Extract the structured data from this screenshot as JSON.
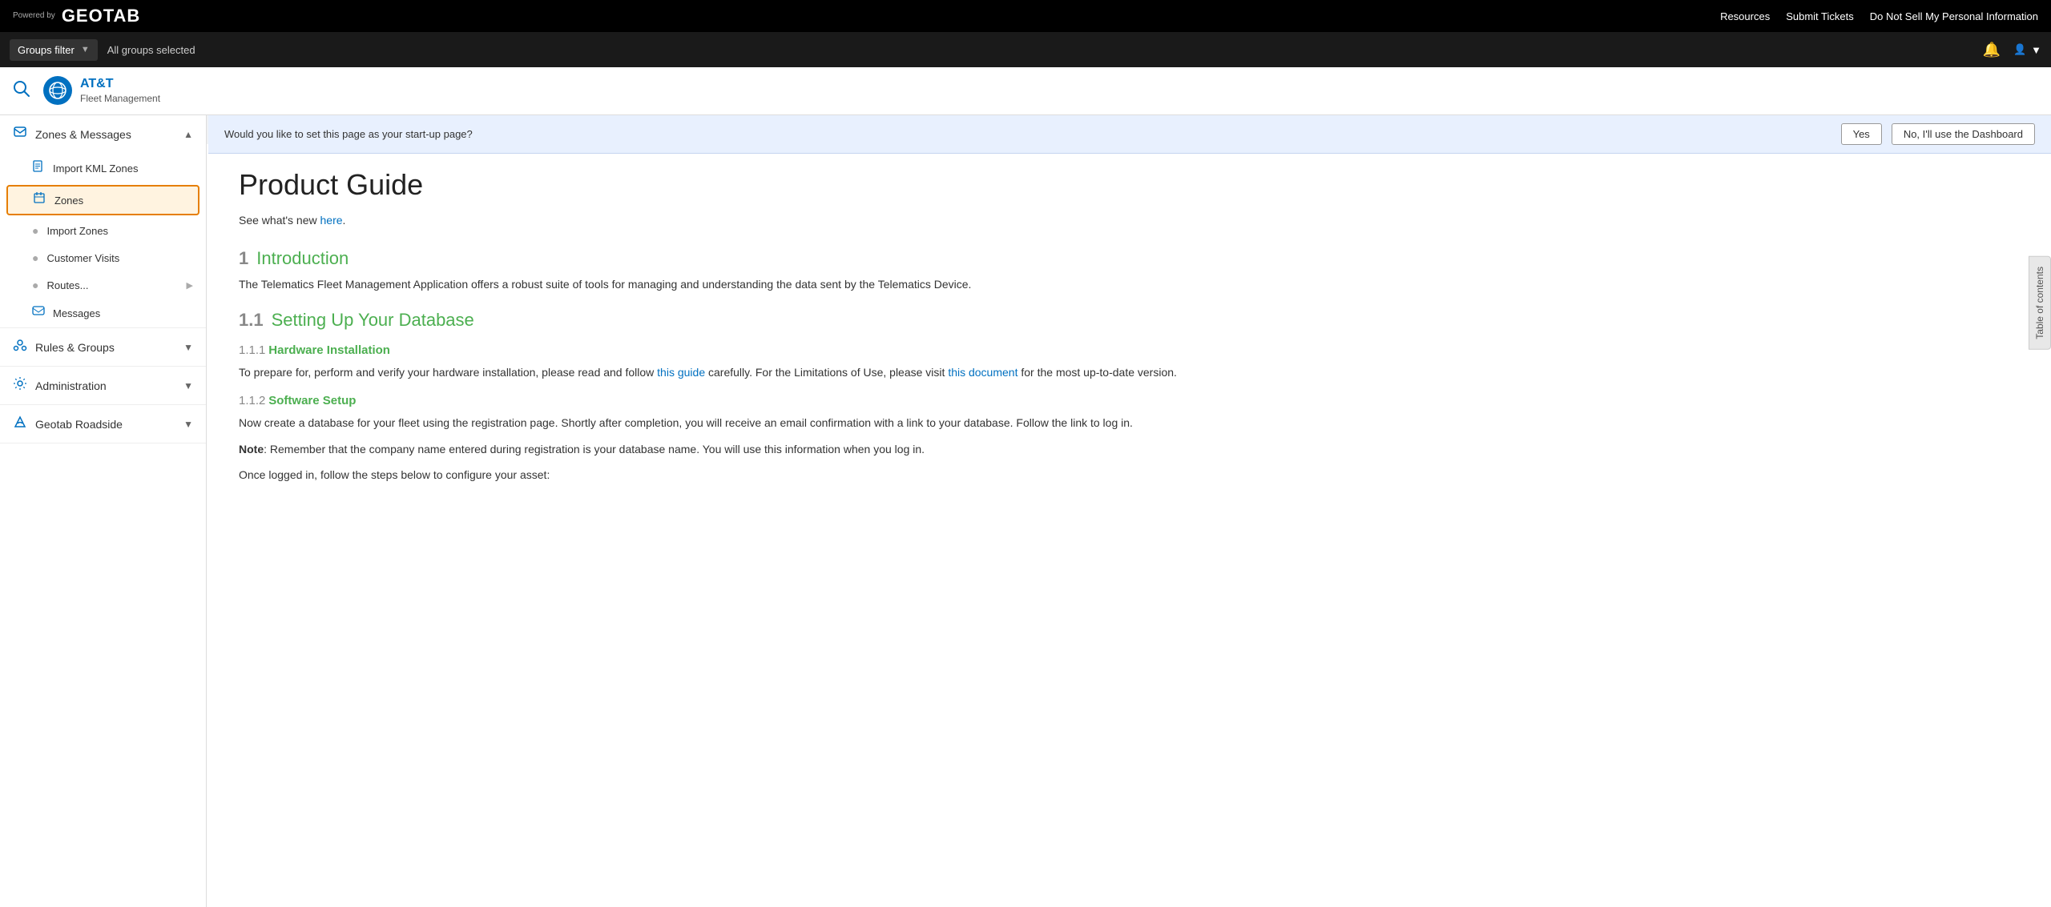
{
  "topbar": {
    "powered_by": "Powered\nby",
    "logo": "GEOTAB",
    "links": {
      "resources": "Resources",
      "submit_tickets": "Submit Tickets",
      "do_not_sell": "Do Not Sell My Personal Information"
    }
  },
  "filterbar": {
    "groups_filter_label": "Groups filter",
    "all_groups_text": "All groups selected"
  },
  "header": {
    "brand": "AT&T",
    "sub": "Fleet Management"
  },
  "startup_banner": {
    "question": "Would you like to set this page as your start-up page?",
    "yes": "Yes",
    "no": "No, I'll use the Dashboard"
  },
  "sidebar": {
    "sections": [
      {
        "id": "zones-messages",
        "label": "Zones & Messages",
        "expanded": true,
        "items": [
          {
            "id": "import-kml-zones",
            "label": "Import KML Zones",
            "icon": "file"
          },
          {
            "id": "zones",
            "label": "Zones",
            "icon": "edit",
            "active": true
          },
          {
            "id": "import-zones",
            "label": "Import Zones",
            "icon": "circle"
          },
          {
            "id": "customer-visits",
            "label": "Customer Visits",
            "icon": "circle"
          },
          {
            "id": "routes",
            "label": "Routes...",
            "icon": "circle",
            "hasArrow": true
          },
          {
            "id": "messages",
            "label": "Messages",
            "icon": "envelope"
          }
        ]
      },
      {
        "id": "rules-groups",
        "label": "Rules & Groups",
        "expanded": false,
        "items": []
      },
      {
        "id": "administration",
        "label": "Administration",
        "expanded": false,
        "items": []
      },
      {
        "id": "geotab-roadside",
        "label": "Geotab Roadside",
        "expanded": false,
        "items": []
      }
    ]
  },
  "content": {
    "title": "Product Guide",
    "see_whats_new_prefix": "See what's new ",
    "here_link": "here",
    "period": ".",
    "sections": [
      {
        "num": "1",
        "title": "Introduction",
        "body": "The Telematics Fleet Management Application offers a robust suite of tools for managing and understanding the data sent by the Telematics Device."
      },
      {
        "num": "1.1",
        "title": "Setting Up Your Database",
        "sub_sections": [
          {
            "num": "1.1.1",
            "title": "Hardware Installation",
            "body_prefix": "To prepare for, perform and verify your hardware installation, please read and follow ",
            "link1_text": "this guide",
            "body_mid": " carefully. For the Limitations of Use, please visit ",
            "link2_text": "this document",
            "body_suffix": " for the most up-to-date version."
          },
          {
            "num": "1.1.2",
            "title": "Software Setup",
            "body": "Now create a database for your fleet using the registration page. Shortly after completion, you will receive an email confirmation with a link to your database. Follow the link to log in.",
            "note_label": "Note",
            "note_body": ": Remember that the company name entered during registration is your database name. You will use this information when you log in.",
            "body2": "Once logged in, follow the steps below to configure your asset:"
          }
        ]
      }
    ]
  },
  "toc_label": "Table of contents"
}
